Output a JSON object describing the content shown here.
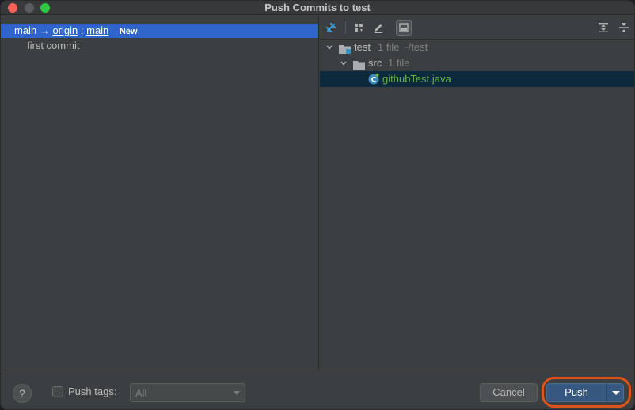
{
  "window": {
    "title": "Push Commits to test"
  },
  "commits_pane": {
    "branch": {
      "local": "main",
      "arrow": "→",
      "remote": "origin",
      "separator": ":",
      "remote_branch": "main",
      "badge": "New"
    },
    "commits": [
      {
        "message": "first commit"
      }
    ]
  },
  "files_pane": {
    "toolbar": {
      "icons": [
        "pin-icon",
        "group-by-icon",
        "edit-source-icon",
        "preview-diff-icon",
        "expand-all-icon",
        "collapse-all-icon"
      ]
    },
    "tree": [
      {
        "name": "test",
        "meta": "1 file  ~/test",
        "type": "module"
      },
      {
        "name": "src",
        "meta": "1 file",
        "type": "folder"
      },
      {
        "name": "githubTest.java",
        "type": "java-file",
        "selected": true
      }
    ]
  },
  "footer": {
    "help_label": "?",
    "push_tags_label": "Push tags:",
    "push_tags_value": "All",
    "cancel_label": "Cancel",
    "push_label": "Push"
  },
  "colors": {
    "selection_blue": "#2f65ca",
    "file_green": "#62b543",
    "highlight_orange": "#e0531b",
    "push_button": "#365880"
  }
}
